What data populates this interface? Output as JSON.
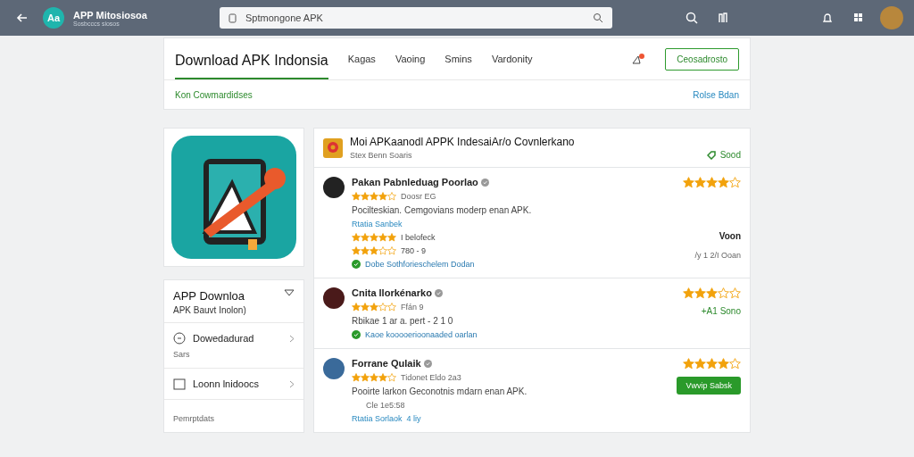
{
  "topbar": {
    "logo": "Aa",
    "brand": "APP Mitosiosoa",
    "brand_sub": "Sosbcccs siosos",
    "search": {
      "value": "Sptmongone APK"
    }
  },
  "header": {
    "title": "Download APK Indonsia",
    "nav": [
      {
        "label": "Kagas",
        "selected": false
      },
      {
        "label": "Vaoing",
        "selected": false
      },
      {
        "label": "Smins",
        "selected": false
      },
      {
        "label": "Vardonity",
        "selected": false
      }
    ],
    "cta": "Ceosadrosto",
    "sub_left": "Kon Cowmardidses",
    "sub_right": "Rolse Bdan"
  },
  "sidebar": {
    "title": "APP Downloa",
    "subtitle": "APK Bauvt Inolon)",
    "items": [
      {
        "kind": "download",
        "label": "Dowedadurad",
        "sub": "Sars"
      },
      {
        "kind": "calendar",
        "label": "Loonn lnidoocs"
      }
    ],
    "section": "Pemrptdats"
  },
  "app": {
    "title": "Moi APKaanodl  APPK IndesaiAr/o Covnlerkano",
    "subtitle": "Stex Benn  Soaris",
    "badge": "Sood"
  },
  "reviews": [
    {
      "name": "Pakan Pabnleduag Poorlao",
      "stars": 4,
      "meta": "Doosr EG",
      "text": "Pocilteskian. Cemgovians moderp enan APK.",
      "link": "Rtatia Sanbek",
      "lines": [
        {
          "kind": "stars",
          "stars": 5,
          "text": "I belofeck"
        },
        {
          "kind": "stars",
          "stars": 3,
          "text": "780 - 9"
        },
        {
          "kind": "check",
          "text": "Dobe Sothforieschelem Dodan"
        }
      ],
      "side": {
        "stars": 4
      },
      "right_label": "Voon",
      "right_sub": "/y 1 2/I Ooan"
    },
    {
      "name": "Cnita llorkénarko",
      "stars": 3,
      "meta": "Ffán 9",
      "text": "Rbikae 1 ar a. pert - 2 1 0",
      "side": {
        "stars": 3
      },
      "lines": [
        {
          "kind": "check",
          "text": "Kaoe kooooerioonaaded oarlan"
        }
      ],
      "right_green": "+A1 Sono"
    },
    {
      "name": "Forrane Qulaik",
      "stars": 4,
      "meta": "Tidonet Eldo 2a3",
      "text": "Pooirte larkon Geconotnis mdarn enan APK.",
      "sub": "Cle 1e5:58",
      "link": "Rtatia Sorlaok",
      "link_extra": "4 liy",
      "side": {
        "stars": 4
      },
      "button": "Vwvip Sabsk"
    }
  ]
}
